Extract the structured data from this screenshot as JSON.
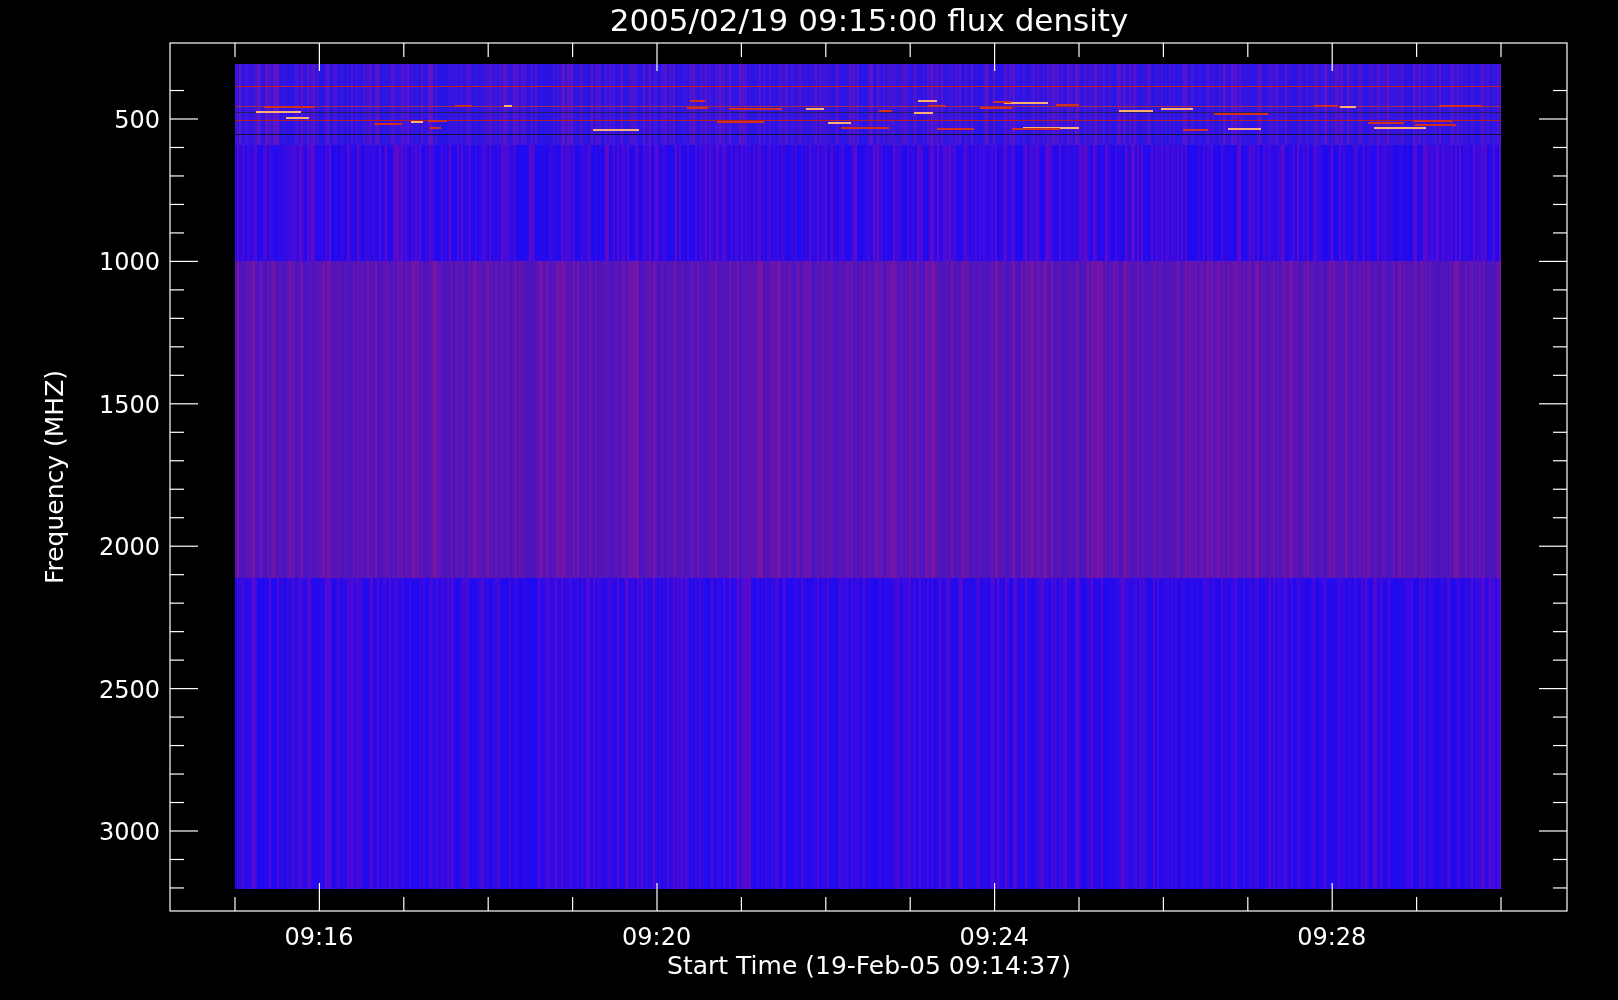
{
  "plot": {
    "title": "2005/02/19 09:15:00 flux density",
    "xlabel": "Start Time (19-Feb-05 09:14:37)",
    "ylabel": "Frequency (MHZ)",
    "y_tick_labels": [
      "500",
      "1000",
      "1500",
      "2000",
      "2500",
      "3000"
    ],
    "x_tick_labels": [
      "09:16",
      "09:20",
      "09:24",
      "09:28"
    ]
  }
}
